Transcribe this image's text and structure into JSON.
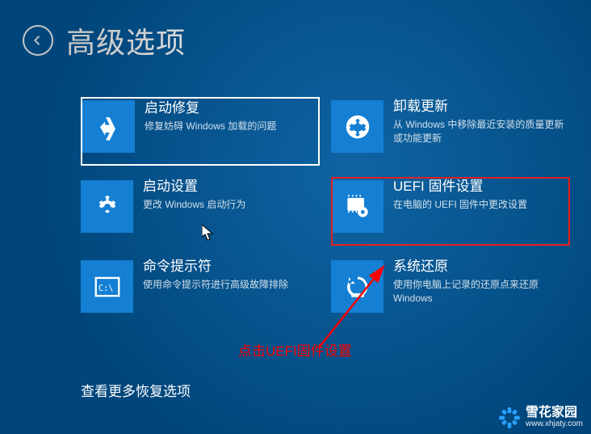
{
  "header": {
    "title": "高级选项"
  },
  "tiles": [
    {
      "title": "启动修复",
      "desc": "修复妨碍 Windows 加载的问题"
    },
    {
      "title": "卸载更新",
      "desc": "从 Windows 中移除最近安装的质量更新或功能更新"
    },
    {
      "title": "启动设置",
      "desc": "更改 Windows 启动行为"
    },
    {
      "title": "UEFI 固件设置",
      "desc": "在电脑的 UEFI 固件中更改设置"
    },
    {
      "title": "命令提示符",
      "desc": "使用命令提示符进行高级故障排除"
    },
    {
      "title": "系统还原",
      "desc": "使用你电脑上记录的还原点来还原 Windows"
    }
  ],
  "more_options": "查看更多恢复选项",
  "annotation": "点击UEFI固件设置",
  "watermark": {
    "name": "雪花家园",
    "url": "www.xhjaty.com"
  }
}
